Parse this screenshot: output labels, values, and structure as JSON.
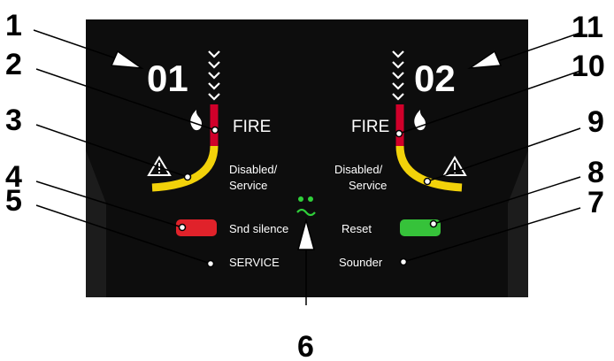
{
  "zones": {
    "left_number": "01",
    "right_number": "02"
  },
  "labels": {
    "fire_left": "FIRE",
    "fire_right": "FIRE",
    "disabled_left_1": "Disabled/",
    "disabled_left_2": "Service",
    "disabled_right_1": "Disabled/",
    "disabled_right_2": "Service",
    "snd_silence": "Snd silence",
    "reset": "Reset",
    "service": "SERVICE",
    "sounder": "Sounder"
  },
  "callouts": [
    "1",
    "2",
    "3",
    "4",
    "5",
    "6",
    "7",
    "8",
    "9",
    "10",
    "11"
  ],
  "colors": {
    "panel": "#0d0d0d",
    "fire_red": "#d0002a",
    "warn_yellow": "#f2d20a",
    "button_red": "#e0222a",
    "button_green": "#36c23a",
    "status_led": "#2fcf3a"
  },
  "icons": {
    "fire": "flame-icon",
    "warning": "warning-triangle-icon",
    "power": "power-tilde-icon",
    "chevrons": "chevron-down-icon"
  }
}
